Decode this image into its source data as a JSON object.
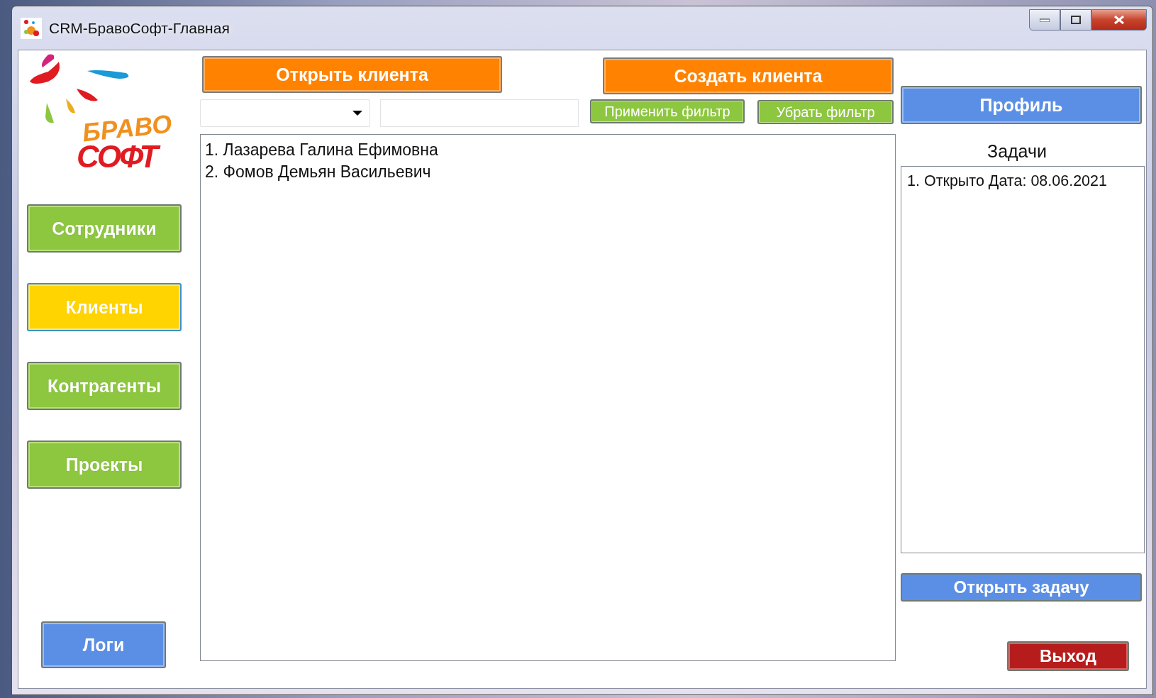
{
  "window": {
    "title": "CRM-БравоСофт-Главная"
  },
  "logo": {
    "line_1": "БРАВО",
    "line_2": "СОФТ"
  },
  "sidebar": {
    "items": [
      {
        "label": "Сотрудники",
        "selected": false
      },
      {
        "label": "Клиенты",
        "selected": true
      },
      {
        "label": "Контрагенты",
        "selected": false
      },
      {
        "label": "Проекты",
        "selected": false
      }
    ],
    "logs_button": "Логи"
  },
  "main": {
    "open_button": "Открыть клиента",
    "create_button": "Создать клиента",
    "apply_filter_button": "Применить фильтр",
    "remove_filter_button": "Убрать фильтр",
    "clients": [
      "1. Лазарева Галина Ефимовна",
      "2. Фомов Демьян Васильевич"
    ]
  },
  "tasks": {
    "profile_button": "Профиль",
    "heading": "Задачи",
    "items": [
      "1. Открыто Дата: 08.06.2021"
    ],
    "open_task_button": "Открыть задачу",
    "exit_button": "Выход"
  }
}
